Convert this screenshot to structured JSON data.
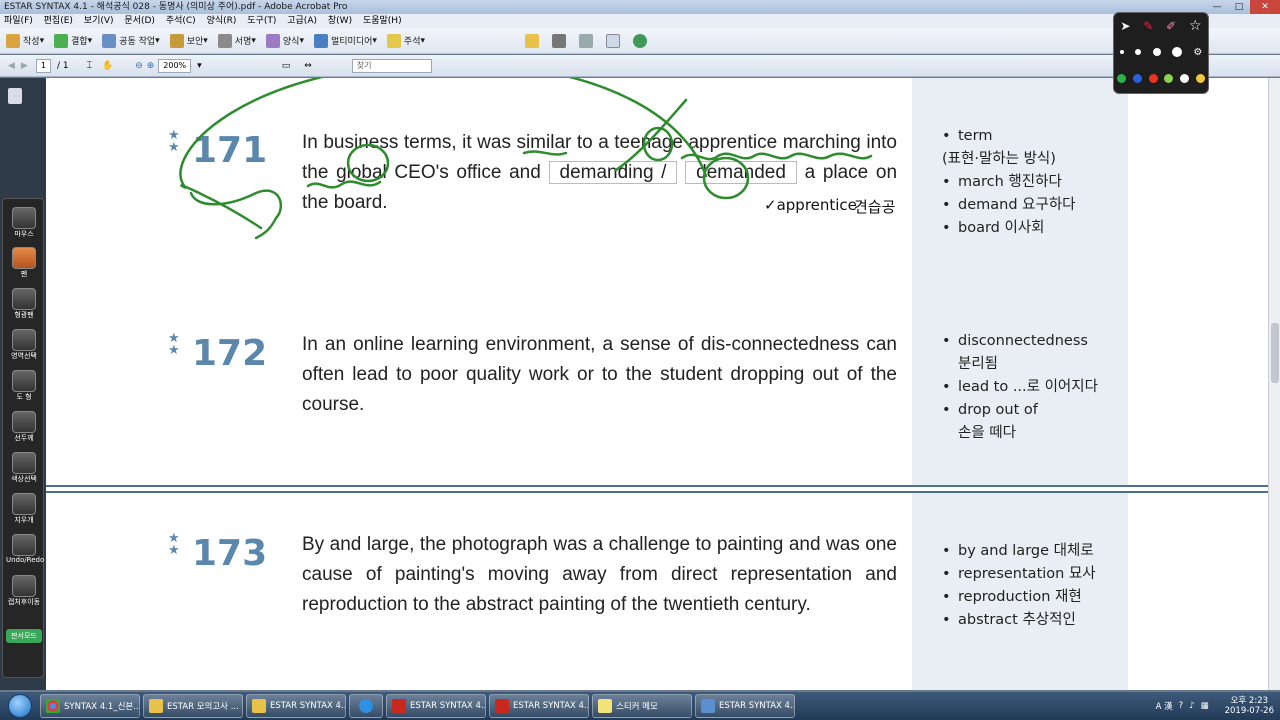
{
  "window": {
    "title": "ESTAR SYNTAX 4.1 - 해석공식 028 - 동명사 (의미상 주어).pdf - Adobe Acrobat Pro",
    "min": "—",
    "max": "□",
    "close": "✕"
  },
  "menu": [
    "파일(F)",
    "편집(E)",
    "보기(V)",
    "문서(D)",
    "주석(C)",
    "양식(R)",
    "도구(T)",
    "고급(A)",
    "창(W)",
    "도움말(H)"
  ],
  "toolbar": {
    "items": [
      "작성",
      "결합",
      "공동 작업",
      "보안",
      "서명",
      "양식",
      "멀티미디어",
      "주석"
    ]
  },
  "nav": {
    "page_current": "1",
    "page_total": "/ 1",
    "zoom": "200%",
    "find_placeholder": "찾기"
  },
  "pen_palette": {
    "items": [
      "마우스",
      "펜",
      "형광펜",
      "영역선택",
      "도 형",
      "선두께",
      "색상선택",
      "지우개",
      "Undo/Redo",
      "캡처후이동",
      "판서모드"
    ]
  },
  "questions": [
    {
      "number": "171",
      "text_before": "In business terms, it was similar to a teenage apprentice marching into the global CEO's office and",
      "choice_a": "demanding /",
      "choice_b": "demanded",
      "text_after": "a place on the board.",
      "vocab": [
        {
          "term": "term",
          "meaning": "(표현·말하는 방식)"
        },
        {
          "term": "march 행진하다",
          "meaning": ""
        },
        {
          "term": "demand 요구하다",
          "meaning": ""
        },
        {
          "term": "board 이사회",
          "meaning": ""
        }
      ]
    },
    {
      "number": "172",
      "text": "In an online learning environment, a sense of dis-connectedness can often lead to poor quality work or to the student dropping out of the course.",
      "vocab": [
        {
          "term": "disconnectedness",
          "meaning": "분리됨"
        },
        {
          "term": "lead to ...로 이어지다",
          "meaning": ""
        },
        {
          "term": "drop out of",
          "meaning": "손을 떼다"
        }
      ]
    },
    {
      "number": "173",
      "text": "By and large, the photograph was a challenge to painting and was one cause of painting's moving away from direct representation and reproduction to the abstract painting of the twentieth century.",
      "vocab": [
        {
          "term": "by and large 대체로",
          "meaning": ""
        },
        {
          "term": "representation 묘사",
          "meaning": ""
        },
        {
          "term": "reproduction 재현",
          "meaning": ""
        },
        {
          "term": "abstract 추상적인",
          "meaning": ""
        }
      ]
    }
  ],
  "annotation": {
    "note_word": "apprentice",
    "note_meaning": "견습공",
    "ink_color": "#2e8b2e"
  },
  "taskbar": {
    "items": [
      "SYNTAX 4.1_신본...",
      "ESTAR 모의고사 ...",
      "ESTAR SYNTAX 4...",
      "ESTAR SYNTAX 4...",
      "ESTAR SYNTAX 4...",
      "스티커 메모",
      "ESTAR SYNTAX 4..."
    ],
    "tray_text": "A 漢",
    "time": "오후 2:23",
    "date": "2019-07-26"
  },
  "colors": {
    "accent_number": "#5b87ad",
    "divider": "#4d6f8f",
    "sidebar_bg": "#e8eef4"
  }
}
